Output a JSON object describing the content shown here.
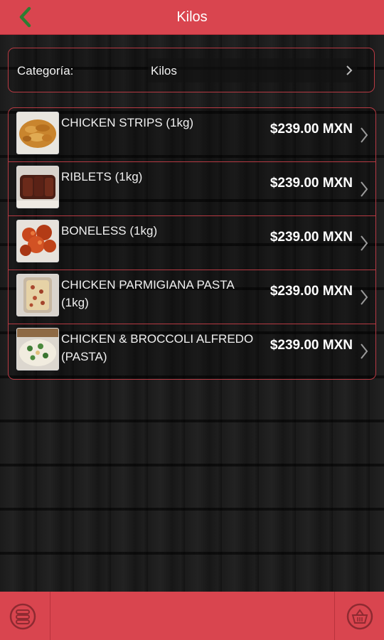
{
  "header": {
    "title": "Kilos",
    "back_icon": "chevron-left-icon",
    "accent_color": "#d9454f",
    "back_icon_color": "#2e7d32"
  },
  "category": {
    "label": "Categoría:",
    "selected": "Kilos",
    "icon": "chevron-right-icon"
  },
  "products": [
    {
      "name": "CHICKEN STRIPS (1kg)",
      "price": "$239.00 MXN",
      "image": "chicken-strips-photo"
    },
    {
      "name": "RIBLETS (1kg)",
      "price": "$239.00 MXN",
      "image": "riblets-photo"
    },
    {
      "name": "BONELESS (1kg)",
      "price": "$239.00 MXN",
      "image": "boneless-photo"
    },
    {
      "name": "CHICKEN PARMIGIANA PASTA (1kg)",
      "price": "$239.00 MXN",
      "image": "parmigiana-pasta-photo"
    },
    {
      "name": "CHICKEN & BROCCOLI ALFREDO (PASTA)",
      "price": "$239.00 MXN",
      "image": "alfredo-pasta-photo"
    }
  ],
  "footer": {
    "menu_icon": "menu-stack-icon",
    "cart_icon": "basket-icon"
  }
}
